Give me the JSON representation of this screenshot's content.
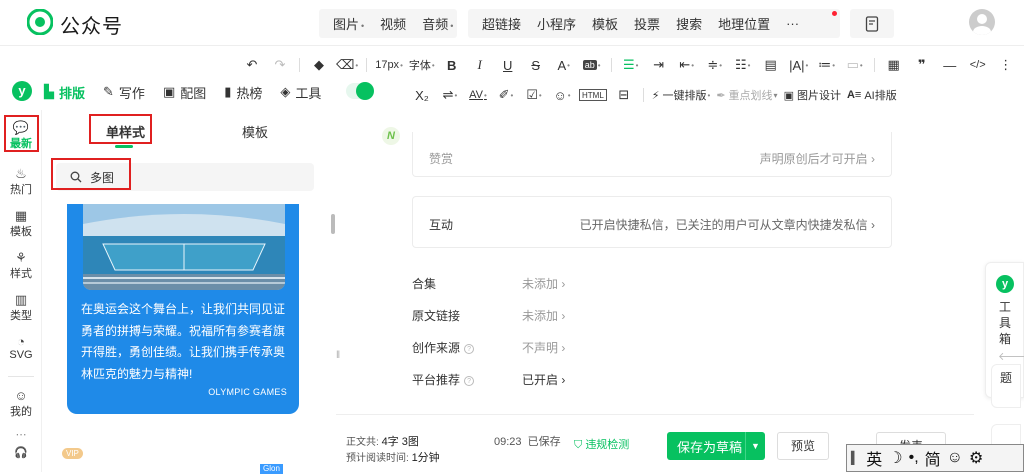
{
  "app": {
    "title": "公众号"
  },
  "insert_menu": {
    "group1": [
      {
        "label": "图片",
        "has_caret": true
      },
      {
        "label": "视频",
        "has_caret": false
      },
      {
        "label": "音频",
        "has_caret": true
      }
    ],
    "group2": [
      {
        "label": "超链接"
      },
      {
        "label": "小程序"
      },
      {
        "label": "模板"
      },
      {
        "label": "投票"
      },
      {
        "label": "搜索"
      },
      {
        "label": "地理位置"
      },
      {
        "label": "···"
      }
    ]
  },
  "format_toolbar": {
    "font_size": "17px",
    "font_family": "字体",
    "one_click_layout": "一键排版",
    "highlight": "重点划线",
    "image_design": "图片设计",
    "ai_layout": "AI排版"
  },
  "left_tabs": [
    {
      "label": "排版",
      "icon": "layout-icon",
      "active": true
    },
    {
      "label": "写作",
      "icon": "pen-icon",
      "active": false
    },
    {
      "label": "配图",
      "icon": "image-icon",
      "active": false
    },
    {
      "label": "热榜",
      "icon": "bookmark-icon",
      "active": false
    },
    {
      "label": "工具",
      "icon": "cube-icon",
      "active": false
    }
  ],
  "sidebar": {
    "items": [
      {
        "label": "最新",
        "icon": "chat-bubble-icon",
        "active": true
      },
      {
        "label": "热门",
        "icon": "flame-icon",
        "active": false
      },
      {
        "label": "模板",
        "icon": "template-icon",
        "active": false
      },
      {
        "label": "样式",
        "icon": "style-icon",
        "active": false
      },
      {
        "label": "类型",
        "icon": "books-icon",
        "active": false
      },
      {
        "label": "SVG",
        "icon": "palette-icon",
        "active": false
      },
      {
        "label": "我的",
        "icon": "user-icon",
        "active": false
      }
    ]
  },
  "panel": {
    "tabs": [
      "单样式",
      "模板"
    ],
    "search_value": "多图",
    "card": {
      "text": "在奥运会这个舞台上，让我们共同见证勇者的拼搏与荣耀。祝福所有参赛者旗开得胜，勇创佳绩。让我们携手传承奥林匹克的魅力与精神!",
      "footer": "OLYMPIC GAMES"
    },
    "vip_badge": "VIP",
    "next_tag": "Glon"
  },
  "editor": {
    "reward": {
      "label": "赞赏",
      "right": "声明原创后才可开启 ›"
    },
    "interaction": {
      "label": "互动",
      "right": "已开启快捷私信，已关注的用户可从文章内快捷发私信 ›"
    },
    "settings": [
      {
        "label": "合集",
        "value": "未添加 ›",
        "help": false
      },
      {
        "label": "原文链接",
        "value": "未添加 ›",
        "help": false
      },
      {
        "label": "创作来源",
        "value": "不声明 ›",
        "help": true
      },
      {
        "label": "平台推荐",
        "value": "已开启 ›",
        "help": true
      }
    ]
  },
  "bottom_bar": {
    "total_label": "正文共:",
    "total_value": "4字 3图",
    "read_label": "预计阅读时间:",
    "read_value": "1分钟",
    "saved_time": "09:23",
    "saved_text": "已保存",
    "check": "违规检测",
    "save_draft": "保存为草稿",
    "preview": "预览",
    "publish": "发表"
  },
  "toolbox": {
    "label": "工具箱",
    "ti": "题"
  },
  "ime": [
    "英",
    "☽",
    "•,",
    "简",
    "☺",
    "⚙"
  ],
  "colors": {
    "accent": "#07c160",
    "card_blue": "#1f8ae8",
    "highlight_red": "#e02020"
  }
}
